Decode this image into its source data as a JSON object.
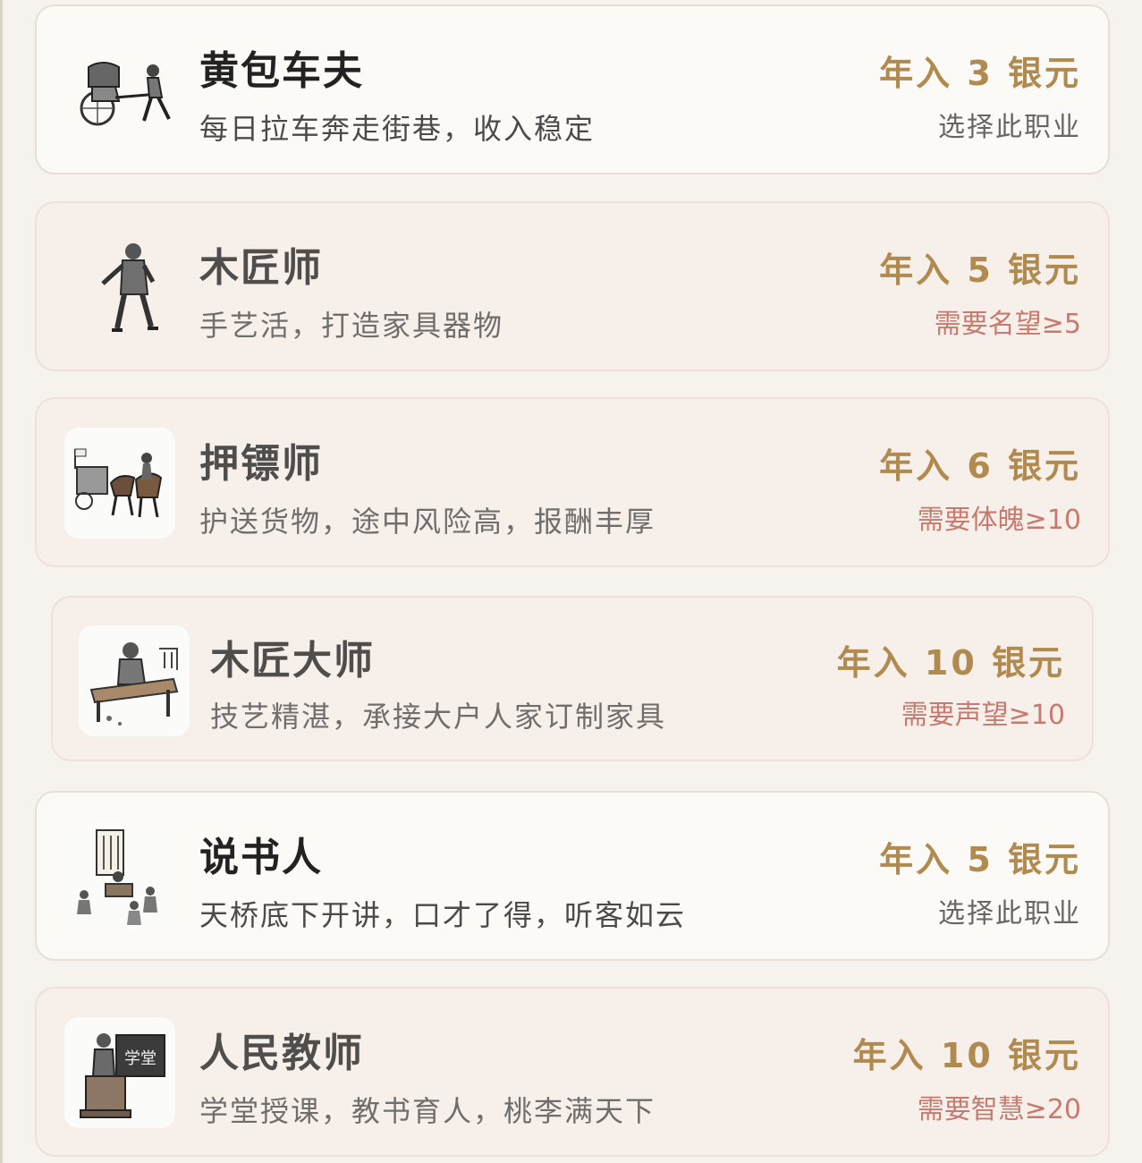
{
  "jobs": [
    {
      "title": "黄包车夫",
      "desc": "每日拉车奔走街巷，收入稳定",
      "income": "年入 3 银元",
      "status": "选择此职业",
      "icon": "rickshaw-puller-icon"
    },
    {
      "title": "木匠师",
      "desc": "手艺活，打造家具器物",
      "income": "年入 5 银元",
      "status": "需要名望≥5",
      "icon": "carpenter-icon"
    },
    {
      "title": "押镖师",
      "desc": "护送货物，途中风险高，报酬丰厚",
      "income": "年入 6 银元",
      "status": "需要体魄≥10",
      "icon": "escort-caravan-icon"
    },
    {
      "title": "木匠大师",
      "desc": "技艺精湛，承接大户人家订制家具",
      "income": "年入 10 银元",
      "status": "需要声望≥10",
      "icon": "master-carpenter-icon"
    },
    {
      "title": "说书人",
      "desc": "天桥底下开讲，口才了得，听客如云",
      "income": "年入 5 银元",
      "status": "选择此职业",
      "icon": "storyteller-icon"
    },
    {
      "title": "人民教师",
      "desc": "学堂授课，教书育人，桃李满天下",
      "income": "年入 10 银元",
      "status": "需要智慧≥20",
      "icon": "teacher-icon",
      "board_text": "学堂"
    }
  ],
  "colors": {
    "income": "#b08a4e",
    "requirement": "#c77b6e",
    "select": "#666666"
  }
}
